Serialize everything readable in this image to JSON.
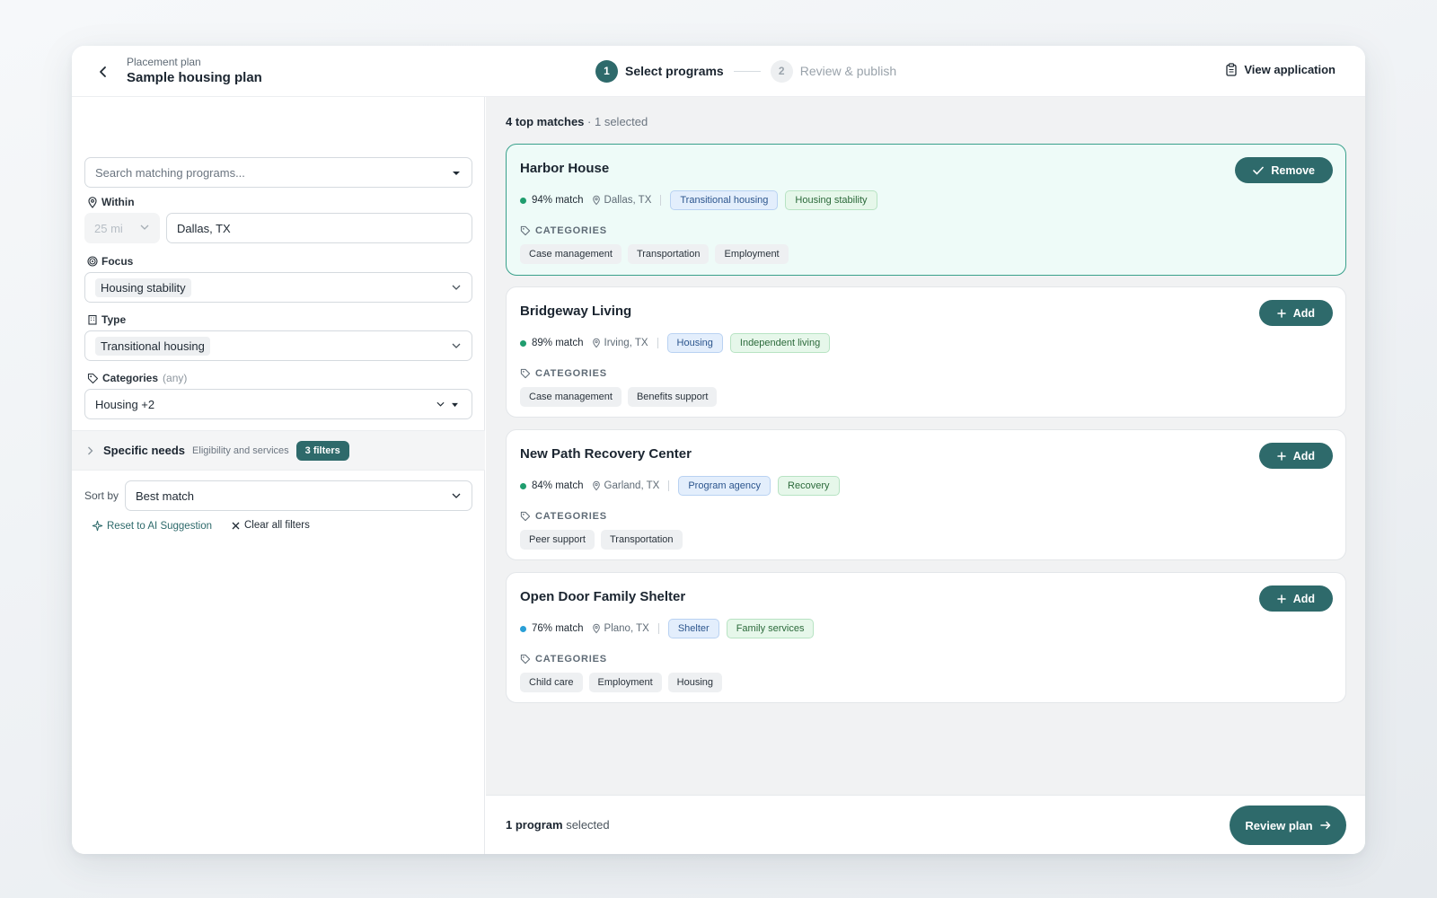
{
  "header": {
    "eyebrow": "Placement plan",
    "title": "Sample housing plan",
    "steps": [
      {
        "num": "1",
        "label": "Select programs",
        "state": "active"
      },
      {
        "num": "2",
        "label": "Review & publish",
        "state": "inactive"
      }
    ],
    "view_application": "View application"
  },
  "filters": {
    "search_placeholder": "Search matching programs...",
    "within_label": "Within",
    "distance_value": "25 mi",
    "location_value": "Dallas, TX",
    "focus_label": "Focus",
    "focus_value": "Housing stability",
    "type_label": "Type",
    "type_value": "Transitional housing",
    "categories_label": "Categories",
    "categories_hint": "(any)",
    "categories_value": "Housing +2",
    "specific_needs_title": "Specific needs",
    "specific_needs_sub": "Eligibility and services",
    "specific_needs_badge": "3 filters",
    "sort_label": "Sort by",
    "sort_value": "Best match",
    "reset_label": "Reset to AI Suggestion",
    "clear_label": "Clear all filters"
  },
  "results": {
    "count_label": "4 top matches",
    "selected_label": "· 1 selected",
    "categories_heading": "CATEGORIES",
    "cards": [
      {
        "name": "Harbor House",
        "match": "94% match",
        "match_color": "#1f9d6e",
        "location": "Dallas, TX",
        "type_tag": "Transitional housing",
        "focus_tag": "Housing stability",
        "categories": [
          "Case management",
          "Transportation",
          "Employment"
        ],
        "action": "Remove",
        "selected": true
      },
      {
        "name": "Bridgeway Living",
        "match": "89% match",
        "match_color": "#1f9d6e",
        "location": "Irving, TX",
        "type_tag": "Housing",
        "focus_tag": "Independent living",
        "categories": [
          "Case management",
          "Benefits support"
        ],
        "action": "Add",
        "selected": false
      },
      {
        "name": "New Path Recovery Center",
        "match": "84% match",
        "match_color": "#1f9d6e",
        "location": "Garland, TX",
        "type_tag": "Program agency",
        "focus_tag": "Recovery",
        "categories": [
          "Peer support",
          "Transportation"
        ],
        "action": "Add",
        "selected": false
      },
      {
        "name": "Open Door Family Shelter",
        "match": "76% match",
        "match_color": "#2a9fd6",
        "location": "Plano, TX",
        "type_tag": "Shelter",
        "focus_tag": "Family services",
        "categories": [
          "Child care",
          "Employment",
          "Housing"
        ],
        "action": "Add",
        "selected": false
      }
    ]
  },
  "footer": {
    "count_bold": "1 program",
    "count_rest": "selected",
    "review_button": "Review plan"
  },
  "colors": {
    "accent": "#2e6a6b",
    "selected_border": "#39a08b",
    "selected_bg": "#eefbf8"
  }
}
